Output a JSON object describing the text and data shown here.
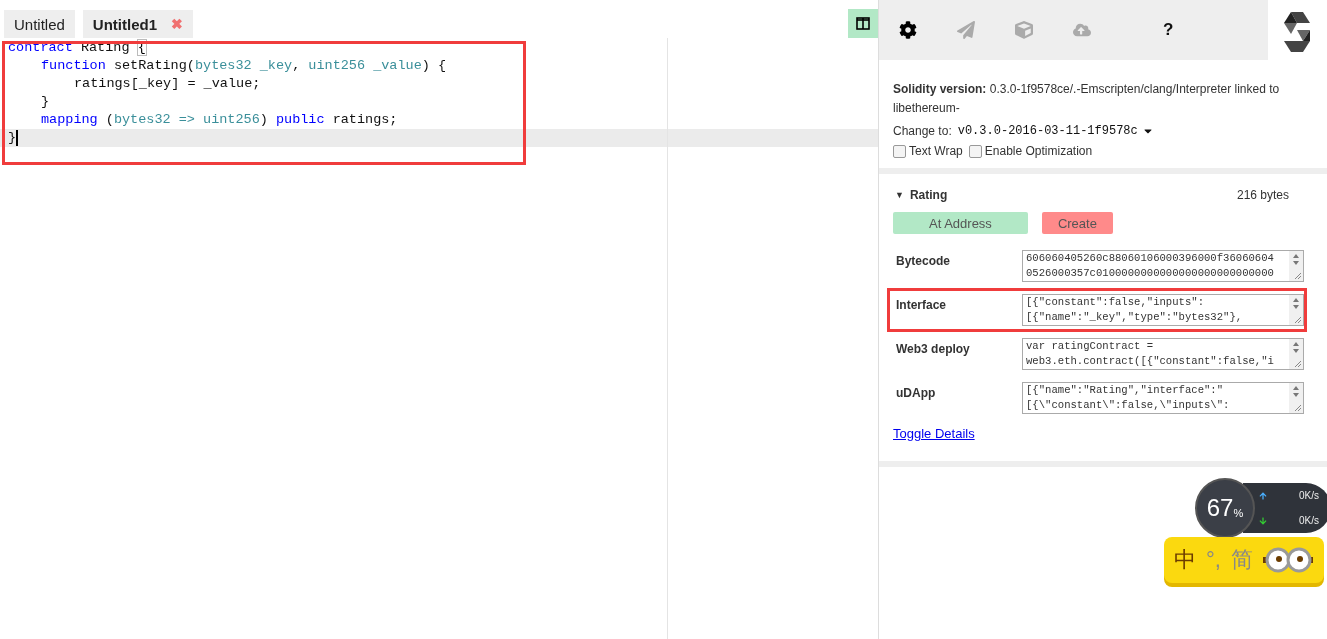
{
  "editor": {
    "tabs": [
      {
        "label": "Untitled",
        "selected": false,
        "closable": false
      },
      {
        "label": "Untitled1",
        "selected": true,
        "closable": true,
        "close_glyph": "✖"
      }
    ],
    "lines": [
      {
        "selected": false,
        "tokens": [
          {
            "kind": "keyword",
            "text": "contract"
          },
          {
            "kind": "plain",
            "text": " Rating "
          },
          {
            "kind": "bracket",
            "text": "{"
          }
        ],
        "children": [
          {
            "selected": false,
            "tokens": [
              {
                "kind": "keyword",
                "text": "function"
              },
              {
                "kind": "plain",
                "text": " setRating("
              },
              {
                "kind": "type",
                "text": "bytes32 _key"
              },
              {
                "kind": "plain",
                "text": ", "
              },
              {
                "kind": "type",
                "text": "uint256 _value"
              },
              {
                "kind": "plain",
                "text": ") {"
              }
            ],
            "children": [
              {
                "selected": false,
                "tokens": [
                  {
                    "kind": "plain",
                    "text": "ratings[_key] = _value;"
                  }
                ]
              }
            ]
          },
          {
            "selected": false,
            "tokens": [
              {
                "kind": "plain",
                "text": "}"
              }
            ]
          },
          {
            "selected": false,
            "tokens": [
              {
                "kind": "keyword",
                "text": "mapping"
              },
              {
                "kind": "plain",
                "text": " ("
              },
              {
                "kind": "type",
                "text": "bytes32 => uint256"
              },
              {
                "kind": "plain",
                "text": ") "
              },
              {
                "kind": "keyword",
                "text": "public"
              },
              {
                "kind": "plain",
                "text": " ratings;"
              }
            ]
          }
        ]
      },
      {
        "selected": true,
        "tokens": [
          {
            "kind": "plain",
            "text": "}"
          }
        ]
      }
    ]
  },
  "toolbar": [
    {
      "kind": "settings",
      "selected": true
    },
    {
      "kind": "send",
      "selected": false
    },
    {
      "kind": "cube",
      "selected": false
    },
    {
      "kind": "upload",
      "selected": false
    },
    {
      "kind": "help",
      "selected": false,
      "text": "?"
    }
  ],
  "settings": {
    "version_label": "Solidity version:",
    "version": "0.3.0-1f9578ce/.-Emscripten/clang/Interpreter linked to libethereum-",
    "change_label": "Change to:",
    "change_value": "v0.3.0-2016-03-11-1f9578c",
    "options": [
      {
        "label": "Text Wrap",
        "checked": false
      },
      {
        "label": "Enable Optimization",
        "checked": false
      }
    ]
  },
  "contract": {
    "name": "Rating",
    "expanded": true,
    "toggle_glyph": "▼",
    "size": "216 bytes",
    "buttons": [
      {
        "label": "At Address",
        "kind": "address"
      },
      {
        "label": "Create",
        "kind": "create"
      }
    ],
    "fields": [
      {
        "label": "Bytecode",
        "highlighted": false,
        "lines": [
          "606060405260c88060106000396000f36060604",
          "0526000357c0100000000000000000000000000"
        ]
      },
      {
        "label": "Interface",
        "highlighted": true,
        "lines": [
          "[{\"constant\":false,\"inputs\":",
          "[{\"name\":\"_key\",\"type\":\"bytes32\"},"
        ]
      },
      {
        "label": "Web3 deploy",
        "highlighted": false,
        "lines": [
          "var ratingContract =",
          "web3.eth.contract([{\"constant\":false,\"i"
        ]
      },
      {
        "label": "uDApp",
        "highlighted": false,
        "lines": [
          "[{\"name\":\"Rating\",\"interface\":\"",
          "[{\\\"constant\\\":false,\\\"inputs\\\":"
        ]
      }
    ],
    "toggle": "Toggle Details"
  },
  "net_meter": {
    "percent": "67",
    "unit": "%",
    "speeds": [
      {
        "kind": "up",
        "text": "0K/s"
      },
      {
        "kind": "down",
        "text": "0K/s"
      }
    ]
  },
  "ime_bar": {
    "items": [
      "中",
      "°,",
      "简"
    ]
  }
}
